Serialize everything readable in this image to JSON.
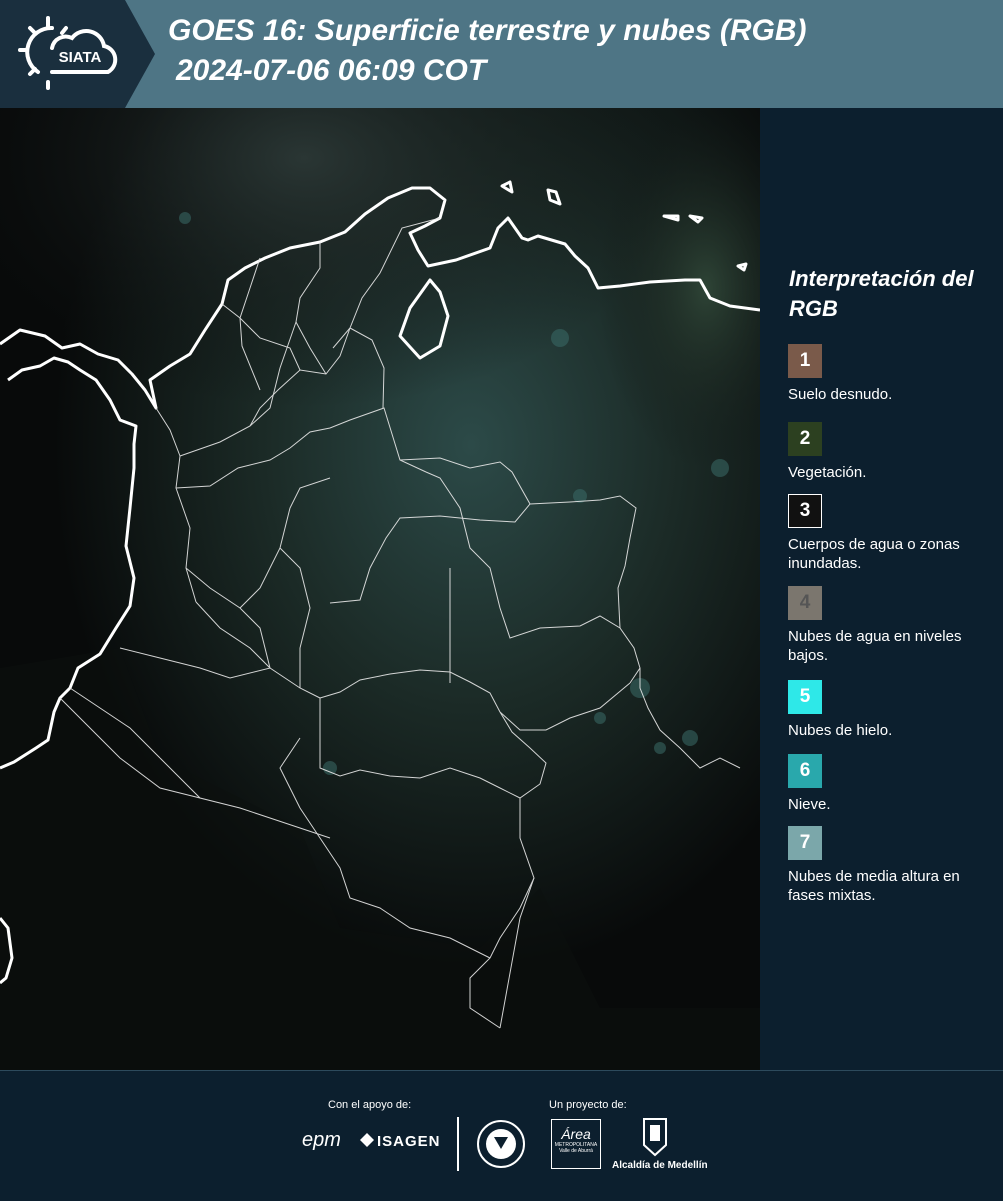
{
  "header": {
    "logo_text": "SIATA",
    "title_line1": "GOES 16: Superficie terrestre y nubes (RGB)",
    "title_line2": "2024-07-06 06:09 COT"
  },
  "legend": {
    "title": "Interpretación del RGB",
    "items": [
      {
        "num": "1",
        "label": "Suelo desnudo.",
        "color": "#7a5a4a",
        "text_color": "#ffffff",
        "border": "#7a5a4a"
      },
      {
        "num": "2",
        "label": "Vegetación.",
        "color": "#2c4020",
        "text_color": "#ffffff",
        "border": "#2c4020"
      },
      {
        "num": "3",
        "label": "Cuerpos de agua o zonas inundadas.",
        "color": "#111111",
        "text_color": "#ffffff",
        "border": "#ffffff"
      },
      {
        "num": "4",
        "label": "Nubes de agua en niveles bajos.",
        "color": "#7b766e",
        "text_color": "#555555",
        "border": "#7b766e"
      },
      {
        "num": "5",
        "label": "Nubes de hielo.",
        "color": "#2ee8e8",
        "text_color": "#ffffff",
        "border": "#2ee8e8"
      },
      {
        "num": "6",
        "label": "Nieve.",
        "color": "#29a8ac",
        "text_color": "#ffffff",
        "border": "#29a8ac"
      },
      {
        "num": "7",
        "label": "Nubes de media altura en fases mixtas.",
        "color": "#7ba7aa",
        "text_color": "#ffffff",
        "border": "#7ba7aa"
      }
    ]
  },
  "footer": {
    "support_caption": "Con el apoyo de:",
    "project_caption": "Un proyecto de:",
    "epm": "epm",
    "isagen": "ISAGEN",
    "area_metro": "Área",
    "area_metro_sub": "METROPOLITANA",
    "area_metro_sub2": "Valle de Aburrá",
    "alcaldia": "Alcaldía de Medellín"
  },
  "colors": {
    "header_bg": "#4e7585",
    "page_bg": "#0c1f2e",
    "logo_bg": "#1a2f3e",
    "map_bg": "#050606",
    "border_line": "#ffffff"
  }
}
